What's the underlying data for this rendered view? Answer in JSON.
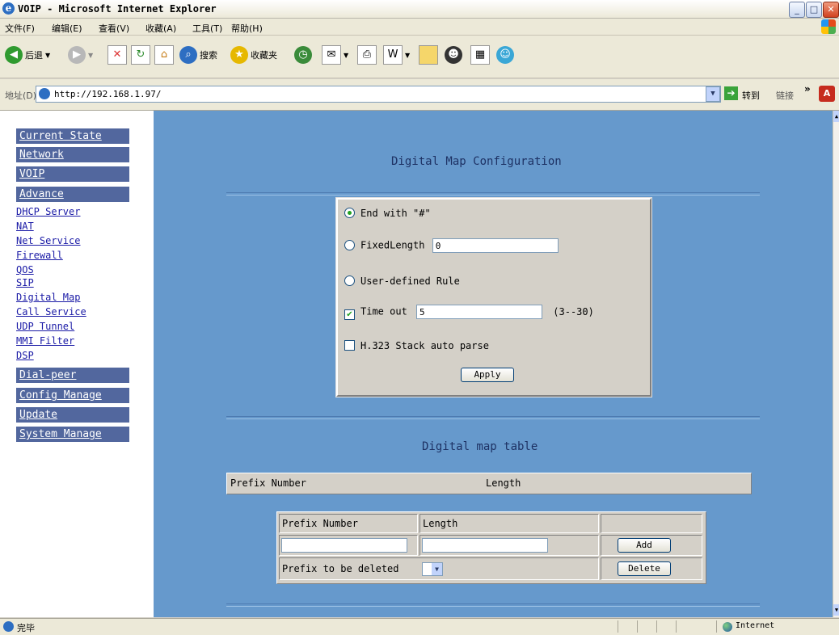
{
  "window": {
    "title": "VOIP - Microsoft Internet Explorer",
    "controls": {
      "minimize": "_",
      "maximize": "□",
      "close": "✕"
    }
  },
  "menu": [
    "文件(F)",
    "编辑(E)",
    "查看(V)",
    "收藏(A)",
    "工具(T)",
    "帮助(H)"
  ],
  "toolbar": {
    "back": "后退",
    "search": "搜索",
    "favorites": "收藏夹"
  },
  "address": {
    "label": "地址(D)",
    "url": "http://192.168.1.97/",
    "go": "转到",
    "links": "链接"
  },
  "sidebar": {
    "top_sections": [
      "Current State",
      "Network",
      "VOIP",
      "Advance"
    ],
    "advance_links": [
      "DHCP Server",
      "NAT",
      "Net Service",
      "Firewall",
      "QOS",
      "SIP",
      "Digital Map",
      "Call Service",
      "UDP Tunnel",
      "MMI Filter",
      "DSP"
    ],
    "bottom_sections": [
      "Dial-peer",
      "Config Manage",
      "Update",
      "System Manage"
    ]
  },
  "page": {
    "title": "Digital Map Configuration",
    "options": {
      "end_with_hash": "End with \"#\"",
      "fixed_length": "FixedLength",
      "fixed_length_value": "0",
      "user_defined": "User-defined Rule",
      "timeout": "Time out",
      "timeout_value": "5",
      "timeout_range": "(3--30)",
      "h323": "H.323 Stack auto parse"
    },
    "selected_option": "end_with_hash",
    "timeout_checked": true,
    "h323_checked": false,
    "apply": "Apply",
    "table_title": "Digital map table",
    "table_columns": [
      "Prefix Number",
      "Length"
    ],
    "edit": {
      "col_prefix": "Prefix Number",
      "col_length": "Length",
      "prefix_value": "",
      "length_value": "",
      "add": "Add",
      "delete_label": "Prefix to be deleted",
      "delete": "Delete"
    }
  },
  "status": {
    "text": "完毕",
    "zone": "Internet"
  }
}
